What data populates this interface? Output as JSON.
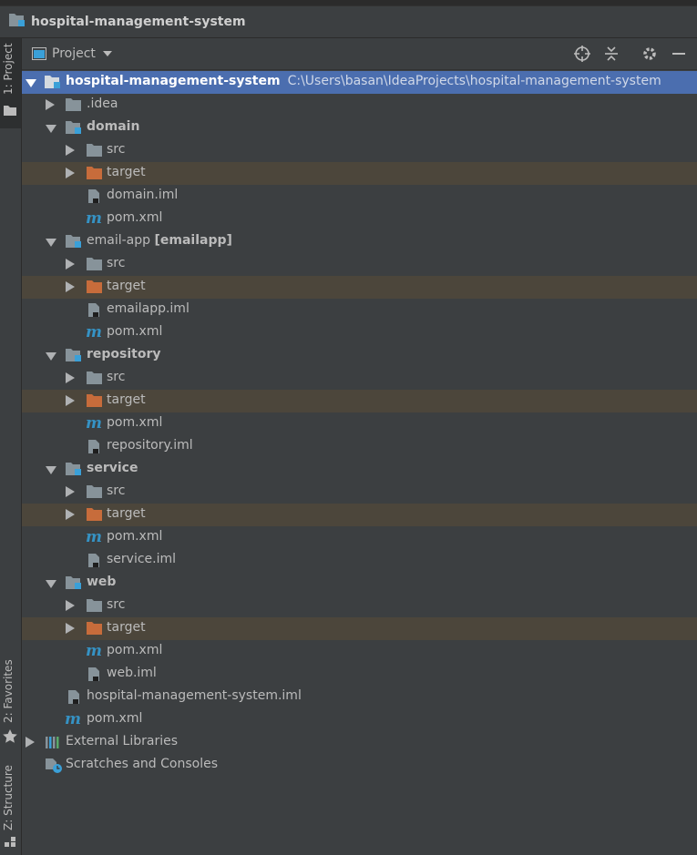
{
  "window": {
    "title": "hospital-management-system"
  },
  "leftbar": {
    "project_tab": "1: Project",
    "favorites_tab": "2: Favorites",
    "structure_tab": "Z: Structure"
  },
  "panel": {
    "title": "Project"
  },
  "tree": {
    "root": {
      "name": "hospital-management-system",
      "path": "C:\\Users\\basan\\IdeaProjects\\hospital-management-system"
    },
    "idea": ".idea",
    "domain": {
      "name": "domain",
      "src": "src",
      "target": "target",
      "iml": "domain.iml",
      "pom": "pom.xml"
    },
    "email": {
      "name": "email-app",
      "qualifier": "[emailapp]",
      "src": "src",
      "target": "target",
      "iml": "emailapp.iml",
      "pom": "pom.xml"
    },
    "repository": {
      "name": "repository",
      "src": "src",
      "target": "target",
      "pom": "pom.xml",
      "iml": "repository.iml"
    },
    "service": {
      "name": "service",
      "src": "src",
      "target": "target",
      "pom": "pom.xml",
      "iml": "service.iml"
    },
    "web": {
      "name": "web",
      "src": "src",
      "target": "target",
      "pom": "pom.xml",
      "iml": "web.iml"
    },
    "root_iml": "hospital-management-system.iml",
    "root_pom": "pom.xml",
    "external_libraries": "External Libraries",
    "scratches": "Scratches and Consoles"
  },
  "colors": {
    "selection": "#4b6eaf",
    "excluded_row": "#4c463b",
    "target_folder": "#c76c3b",
    "folder": "#87939a",
    "module_badge": "#3aa0d8",
    "maven": "#3592c4"
  }
}
